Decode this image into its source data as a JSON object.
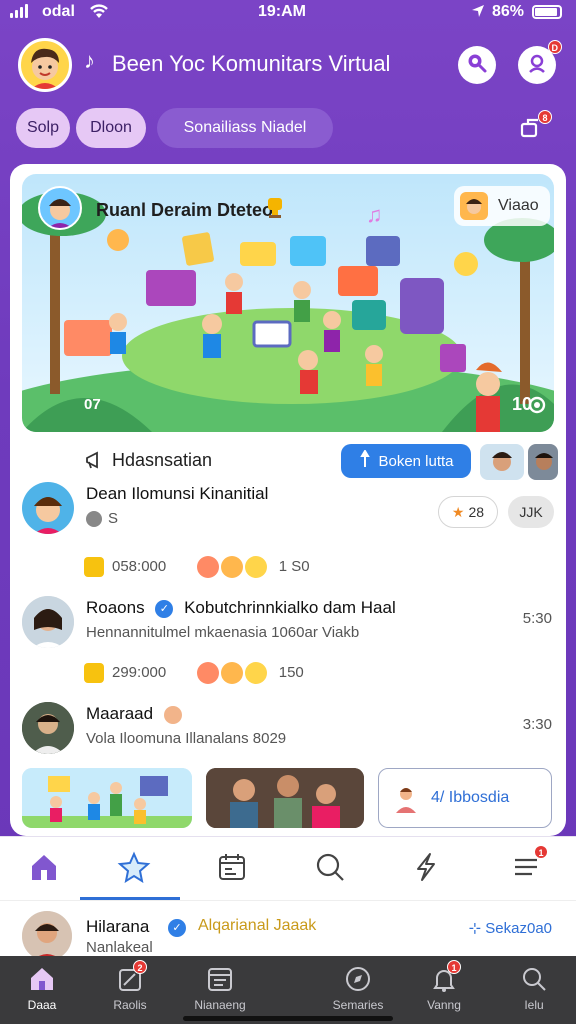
{
  "status_bar": {
    "carrier": "odal",
    "time": "19:AM",
    "battery": "86%"
  },
  "header": {
    "title": "Been Yoc Komunitars Virtual"
  },
  "chips": [
    {
      "label": "Solp"
    },
    {
      "label": "Dloon"
    },
    {
      "label": "Sonailiass Niadel"
    }
  ],
  "banner": {
    "title": "Ruanl Deraim Dteteo",
    "tag": "Viaao",
    "counter_left": "07",
    "counter_right": "10"
  },
  "section": {
    "title": "Hdasnsatian",
    "join_label": "Boken lutta"
  },
  "posts": [
    {
      "name": "Dean Ilomunsi Kinanitial",
      "sub": "S",
      "like_count": "28",
      "pill_label": "JJK",
      "stats": "058:000",
      "reactions": "1 S0"
    },
    {
      "name": "Roaons",
      "headline": "Kobutchrinnkialko dam Haal",
      "sub": "Hennannitulmel mkaenasia 1060ar Viakb",
      "time": "5:30",
      "stats": "299:000",
      "reactions": "150"
    },
    {
      "name": "Maaraad",
      "sub": "Vola Iloomuna Illanalans 8029",
      "time": "3:30"
    }
  ],
  "bottom_card": {
    "label": "4/ Ibbosdia"
  },
  "notif": {
    "name": "Hilarana",
    "action": "Alqarianal Jaaak",
    "sub": "Nanlakeal",
    "link": "Sekaz0a0"
  },
  "nav": [
    {
      "label": "Daaa",
      "icon": "home-icon"
    },
    {
      "label": "Raolis",
      "icon": "edit-icon",
      "badge": "2"
    },
    {
      "label": "Nianaeng",
      "icon": "calendar-icon"
    },
    {
      "label": "Semaries",
      "icon": "explore-icon"
    },
    {
      "label": "Vanng",
      "icon": "bell-icon",
      "badge": "1"
    },
    {
      "label": "Ielu",
      "icon": "search-icon"
    }
  ],
  "colors": {
    "header_purple": "#7b44c6",
    "accent_blue": "#2f7fe6",
    "badge_red": "#e53935",
    "navbar_dark": "#3a3a3c"
  }
}
